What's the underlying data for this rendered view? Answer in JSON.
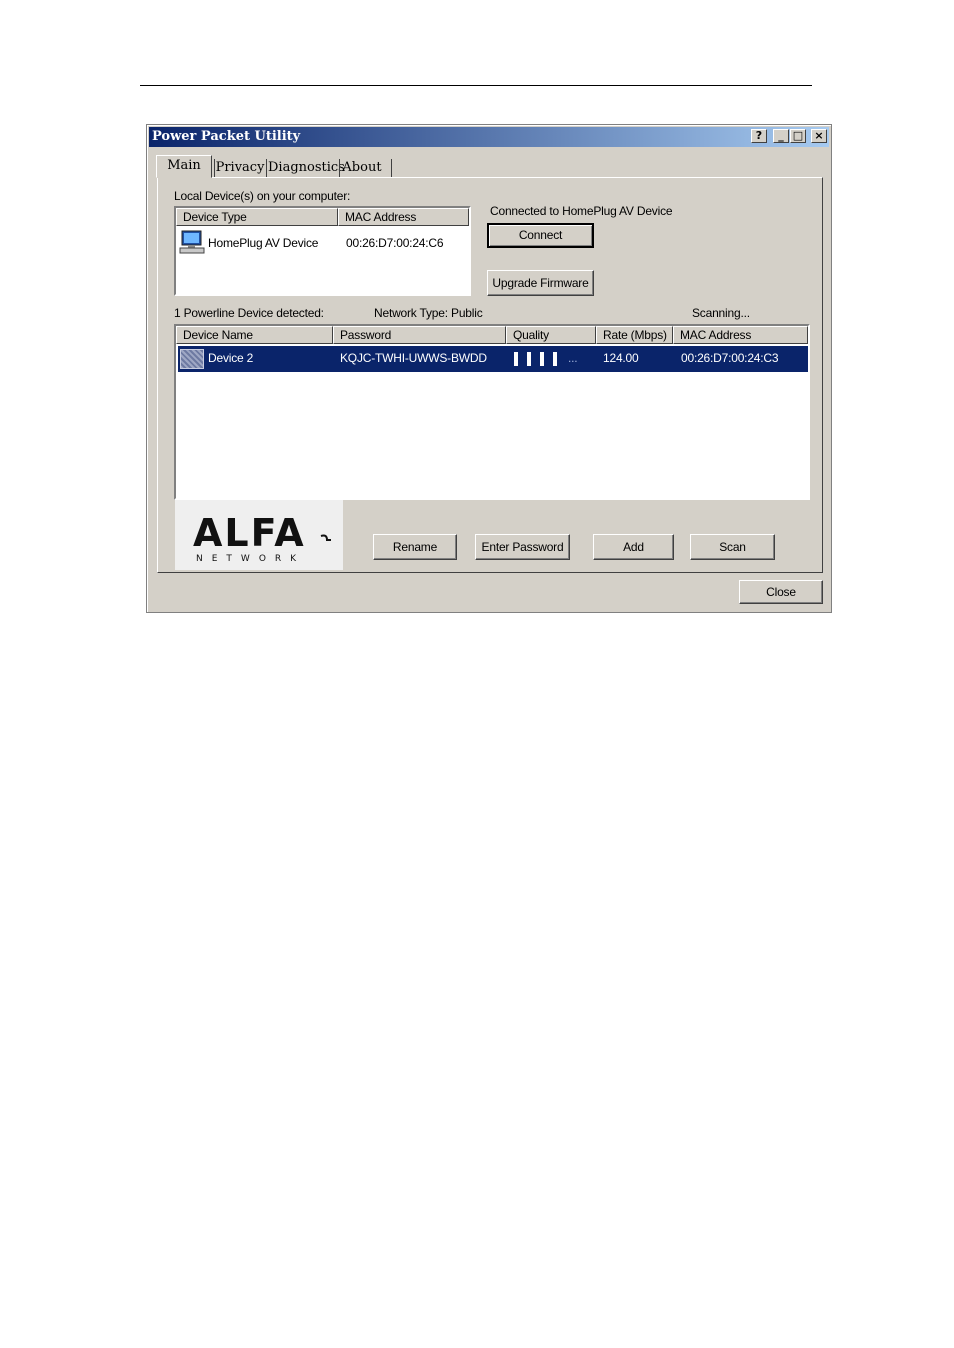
{
  "window": {
    "title": "Power Packet Utility",
    "caption_buttons": [
      "?",
      "_",
      "□",
      "×"
    ]
  },
  "tabs": [
    {
      "label": "Main",
      "active": true
    },
    {
      "label": "Privacy",
      "active": false
    },
    {
      "label": "Diagnostics",
      "active": false
    },
    {
      "label": "About",
      "active": false
    }
  ],
  "local": {
    "caption": "Local Device(s) on your computer:",
    "columns": [
      "Device Type",
      "MAC Address"
    ],
    "rows": [
      {
        "icon": "computer-icon",
        "type": "HomePlug AV Device",
        "mac": "00:26:D7:00:24:C6"
      }
    ],
    "connected_text": "Connected to HomePlug AV Device",
    "connect_label": "Connect",
    "upgrade_label": "Upgrade Firmware"
  },
  "powerline": {
    "detected_text": "1 Powerline Device detected:",
    "network_type": "Network Type: Public",
    "status": "Scanning...",
    "columns": [
      "Device Name",
      "Password",
      "Quality",
      "Rate (Mbps)",
      "MAC Address"
    ],
    "rows": [
      {
        "icon": "device-icon",
        "name": "Device 2",
        "password": "KQJC-TWHI-UWWS-BWDD",
        "quality_bars": 4,
        "quality_suffix": "...",
        "rate": "124.00",
        "mac": "00:26:D7:00:24:C3",
        "selected": true
      }
    ]
  },
  "actions": {
    "rename": "Rename",
    "enter_password": "Enter Password",
    "add": "Add",
    "scan": "Scan"
  },
  "logo": {
    "word": "ALFA",
    "sub": "NETWORK"
  },
  "footer": {
    "close": "Close"
  },
  "colors": {
    "titlebar_start": "#0a246a",
    "titlebar_end": "#a6caf0",
    "selection": "#0a246a",
    "face": "#d4d0c8"
  }
}
